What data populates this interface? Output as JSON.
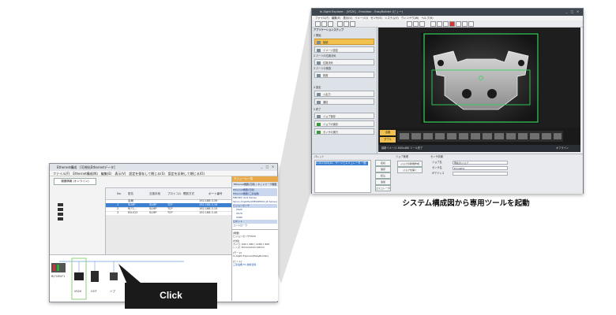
{
  "caption": "システム構成図から専用ツールを起動",
  "click_label": "Click",
  "left_window": {
    "title": "Ethernet構成　[可視化Ethernetデータ]",
    "menu": "ファイル(F)　Ethernet構成(N)　編集(E)　表示(V)　設定を保存して閉じる(S)　設定を反映して閉じる(O)",
    "tool_button": "機器情報 (オンライン)",
    "grid_headers": [
      "No.",
      "型名",
      "交換手段",
      "プロトコル",
      "開放方式",
      "ポート番号"
    ],
    "grid_rows": [
      [
        "",
        "自局",
        "",
        "",
        "",
        "192.168.3.39"
      ],
      [
        "1",
        "SLMP",
        "SLMP",
        "TCP",
        "",
        "192.168.3.16"
      ],
      [
        "2",
        "RJ71...",
        "SLMP",
        "TCP",
        "",
        "192.168.3.15"
      ],
      [
        "3",
        "EN-IQ3",
        "SLMP",
        "TCP",
        "",
        "192.168.3.45"
      ]
    ],
    "panel_title": "モジュール一覧",
    "panel_tabs": "Ethernet機器(汎用) | ネットワーク機器 | ...",
    "panel_items": [
      "Ethernet機器(汎用)",
      "Ethernet機器(三菱電機)",
      "MELSEC iQ-R Series",
      "Servo Amplifier(MELSERVO-J4 Series)",
      "ビジョンセンサ",
      "VS20",
      "VS70",
      "VS80",
      "ロボット",
      "コントローラ"
    ],
    "description": [
      "[概要]",
      "ビジョンセンサVS20",
      "[仕様]",
      "カメラ: 640 x 480 / 1280 x 960",
      "レンズ: 8mm/12mm/16mm",
      "[モード]",
      "In-Sight Explorer(EasyBuilder)",
      "[ヒント]",
      "三菱電機 FA 技術資料"
    ],
    "net_labels": [
      "RJ71EN71",
      "VS20",
      "GOT",
      "ハブ"
    ]
  },
  "right_window": {
    "title": "In-Sight Explorer - [VS20] - Emulator - EasyBuilder (ビュー)",
    "menu": "ファイル(F)　編集(E)　表示(V)　イメージ(I)　センサ(S)　システム(Y)　ウィンドウ(W)　ヘルプ(H)",
    "sidebar_heading": "アプリケーションステップ",
    "sections": [
      {
        "heading": "1 開始",
        "items": [
          "接続",
          "イメージ設定"
        ]
      },
      {
        "heading": "2 パーツの位置決め",
        "items": [
          "位置決め"
        ]
      },
      {
        "heading": "3 パーツの検査",
        "items": [
          "検査"
        ]
      },
      {
        "heading": "4 設定",
        "items": [
          "入出力",
          "通信"
        ]
      },
      {
        "heading": "5 終了",
        "items": [
          "ジョブ保存",
          "ジョブの保存",
          "センサの実行"
        ]
      }
    ],
    "strip_buttons": [
      "合格",
      "ダブル"
    ],
    "status_text": "最新イメージ: 640x480 ツール完了",
    "status_right": "オフライン",
    "bottom_left_label": "パレット",
    "bottom_list": [
      "0 2017/03/10 - ゲージとエミュレータ 一般"
    ],
    "bottom_buttons": [
      "接続",
      "保存",
      "読込",
      "追加",
      "エミュレータ"
    ],
    "bottom_mid_title": "ジョブ管理",
    "bottom_mid_buttons": [
      "ジョブの新規作成",
      "ジョブを開く"
    ],
    "bottom_right_title": "センサ情報",
    "bottom_right_fields": [
      {
        "label": "ジョブ名",
        "value": "現在のジョブ"
      },
      {
        "label": "センサ名",
        "value": "Emulator"
      },
      {
        "label": "IPアドレス",
        "value": ""
      }
    ]
  },
  "colors": {
    "accent": "#f1c04d",
    "selection": "#3b7fd0",
    "roi": "#35d35a",
    "callout": "#1a1a1a"
  }
}
